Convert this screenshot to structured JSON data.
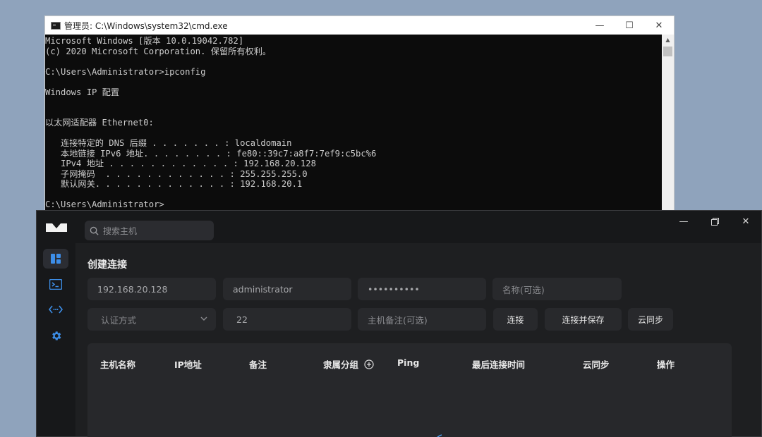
{
  "cmd": {
    "title": "管理员: C:\\Windows\\system32\\cmd.exe",
    "lines": [
      "Microsoft Windows [版本 10.0.19042.782]",
      "(c) 2020 Microsoft Corporation. 保留所有权利。",
      "",
      "C:\\Users\\Administrator>ipconfig",
      "",
      "Windows IP 配置",
      "",
      "",
      "以太网适配器 Ethernet0:",
      "",
      "   连接特定的 DNS 后缀 . . . . . . . : localdomain",
      "   本地链接 IPv6 地址. . . . . . . . : fe80::39c7:a8f7:7ef9:c5bc%6",
      "   IPv4 地址 . . . . . . . . . . . . : 192.168.20.128",
      "   子网掩码  . . . . . . . . . . . . : 255.255.255.0",
      "   默认网关. . . . . . . . . . . . . : 192.168.20.1",
      "",
      "C:\\Users\\Administrator>"
    ]
  },
  "app": {
    "search_placeholder": "搜索主机",
    "heading": "创建连接",
    "form": {
      "host": "192.168.20.128",
      "username": "administrator",
      "password": "••••••••••",
      "name_placeholder": "名称(可选)",
      "auth_method": "认证方式",
      "port": "22",
      "note_placeholder": "主机备注(可选)"
    },
    "buttons": {
      "connect": "连接",
      "connect_save": "连接并保存",
      "cloud_sync": "云同步"
    },
    "table_headers": [
      "主机名称",
      "IP地址",
      "备注",
      "隶属分组",
      "Ping",
      "最后连接时间",
      "云同步",
      "操作"
    ],
    "colors": {
      "accent": "#3d8ee8",
      "bg": "#1e1f21",
      "field": "#28292c"
    }
  }
}
